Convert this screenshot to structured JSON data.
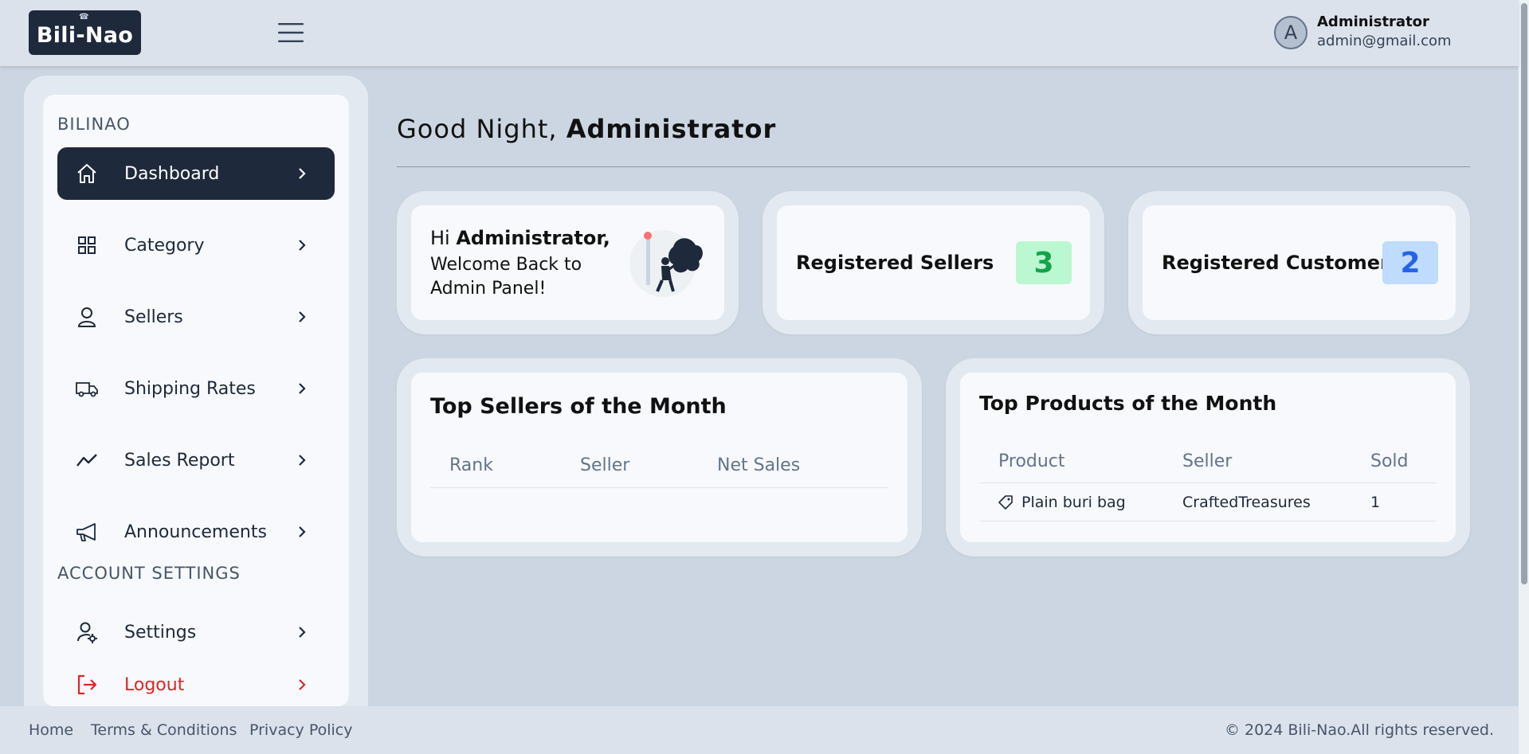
{
  "header": {
    "logo_text": "Bili-Nao",
    "user_initial": "A",
    "user_name": "Administrator",
    "user_email": "admin@gmail.com"
  },
  "sidebar": {
    "section_main": "BILINAO",
    "items": [
      {
        "label": "Dashboard",
        "icon": "home-icon"
      },
      {
        "label": "Category",
        "icon": "grid-icon"
      },
      {
        "label": "Sellers",
        "icon": "user-icon"
      },
      {
        "label": "Shipping Rates",
        "icon": "truck-icon"
      },
      {
        "label": "Sales Report",
        "icon": "trend-icon"
      },
      {
        "label": "Announcements",
        "icon": "megaphone-icon"
      }
    ],
    "section_account": "ACCOUNT SETTINGS",
    "settings_label": "Settings",
    "logout_label": "Logout"
  },
  "main": {
    "greeting_prefix": "Good Night, ",
    "greeting_name": "Administrator",
    "welcome_card": {
      "hi": "Hi ",
      "name": "Administrator,",
      "message": "Welcome Back to Admin Panel!"
    },
    "stats": [
      {
        "label": "Registered Sellers",
        "value": "3",
        "color": "#16a34a",
        "bg": "#bbf7d0"
      },
      {
        "label": "Registered Customers",
        "value": "2",
        "color": "#2563eb",
        "bg": "#bfdbfe"
      }
    ],
    "top_sellers": {
      "title": "Top Sellers of the Month",
      "columns": [
        "Rank",
        "Seller",
        "Net Sales"
      ]
    },
    "top_products": {
      "title": "Top Products of the Month",
      "columns": [
        "Product",
        "Seller",
        "Sold"
      ],
      "rows": [
        {
          "product": "Plain buri bag",
          "seller": "CraftedTreasures",
          "sold": "1"
        }
      ]
    }
  },
  "footer": {
    "links": [
      "Home",
      "Terms & Conditions",
      "Privacy Policy"
    ],
    "copyright": "© 2024 Bili-Nao.All rights reserved."
  },
  "colors": {
    "primary": "#1e293b",
    "logout": "#dc2626",
    "background": "#ccd6e2"
  }
}
